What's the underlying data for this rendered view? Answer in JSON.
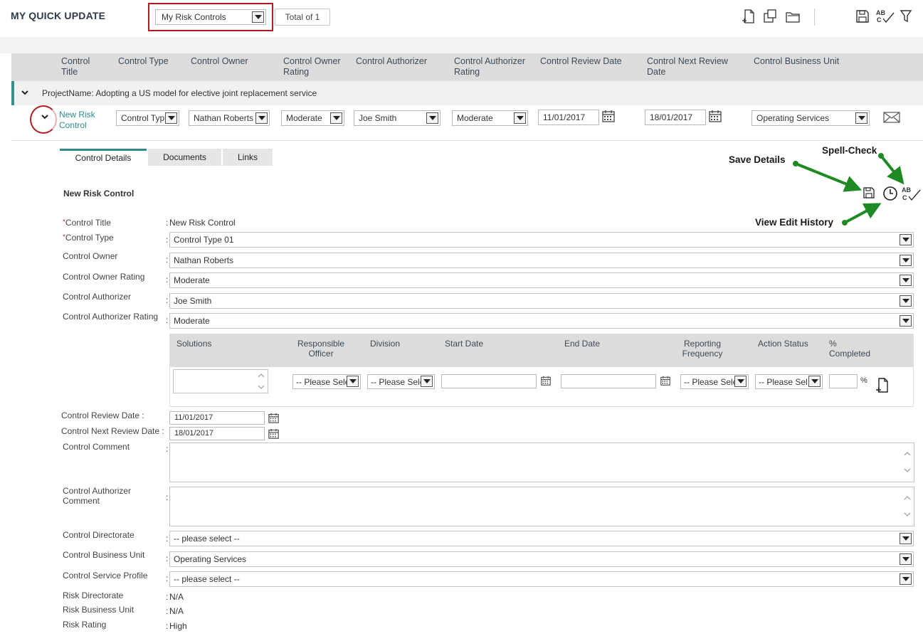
{
  "header": {
    "title": "MY QUICK UPDATE",
    "view_select": "My Risk Controls",
    "total": "Total of 1"
  },
  "grid": {
    "columns": [
      "Control Title",
      "Control Type",
      "Control Owner",
      "Control Owner Rating",
      "Control Authorizer",
      "Control Authorizer Rating",
      "Control Review Date",
      "Control Next Review Date",
      "Control Business Unit"
    ],
    "group_label": "ProjectName: Adopting a US model for elective joint replacement service",
    "row": {
      "title": "New Risk Control",
      "type": "Control Typ",
      "owner": "Nathan Roberts",
      "owner_rating": "Moderate",
      "authorizer": "Joe Smith",
      "authorizer_rating": "Moderate",
      "review_date": "11/01/2017",
      "next_review_date": "18/01/2017",
      "business_unit": "Operating Services"
    }
  },
  "tabs": [
    "Control Details",
    "Documents",
    "Links"
  ],
  "detail": {
    "section_title": "New Risk Control",
    "fields": {
      "control_title_label": "Control Title",
      "control_title_value": "New Risk Control",
      "control_type_label": "Control Type",
      "control_type_value": "Control Type 01",
      "control_owner_label": "Control Owner",
      "control_owner_value": "Nathan Roberts",
      "owner_rating_label": "Control Owner Rating",
      "owner_rating_value": "Moderate",
      "authorizer_label": "Control Authorizer",
      "authorizer_value": "Joe Smith",
      "authorizer_rating_label": "Control Authorizer Rating",
      "authorizer_rating_value": "Moderate",
      "review_date_label": "Control Review Date :",
      "review_date_value": "11/01/2017",
      "next_review_date_label": "Control Next Review Date :",
      "next_review_date_value": "18/01/2017",
      "comment_label": "Control Comment",
      "auth_comment_label": "Control Authorizer Comment",
      "directorate_label": "Control Directorate",
      "directorate_value": "-- please select --",
      "business_unit_label": "Control Business Unit",
      "business_unit_value": "Operating Services",
      "service_profile_label": "Control Service Profile",
      "service_profile_value": "-- please select --",
      "risk_directorate_label": "Risk Directorate",
      "risk_directorate_value": "N/A",
      "risk_business_unit_label": "Risk Business Unit",
      "risk_business_unit_value": "N/A",
      "risk_rating_label": "Risk Rating",
      "risk_rating_value": "High"
    },
    "solutions": {
      "headers": {
        "solutions": "Solutions",
        "officer": "Responsible Officer",
        "division": "Division",
        "start": "Start Date",
        "end": "End Date",
        "frequency": "Reporting Frequency",
        "status": "Action Status",
        "completed": "% Completed"
      },
      "please_select": "-- Please Sele",
      "please_select_short": "-- Please Sel",
      "percent_sign": "%"
    }
  },
  "annotations": {
    "save": "Save Details",
    "spell": "Spell-Check",
    "history": "View Edit History"
  },
  "icons": [
    "new-document-icon",
    "copy-icon",
    "folder-icon",
    "save-icon",
    "spell-check-icon",
    "filter-icon",
    "calendar-icon",
    "mail-icon",
    "clock-icon",
    "chevron-down-icon"
  ],
  "colors": {
    "accent": "#2e8b88",
    "highlight": "#b01e23",
    "arrow": "#1f8a24"
  }
}
